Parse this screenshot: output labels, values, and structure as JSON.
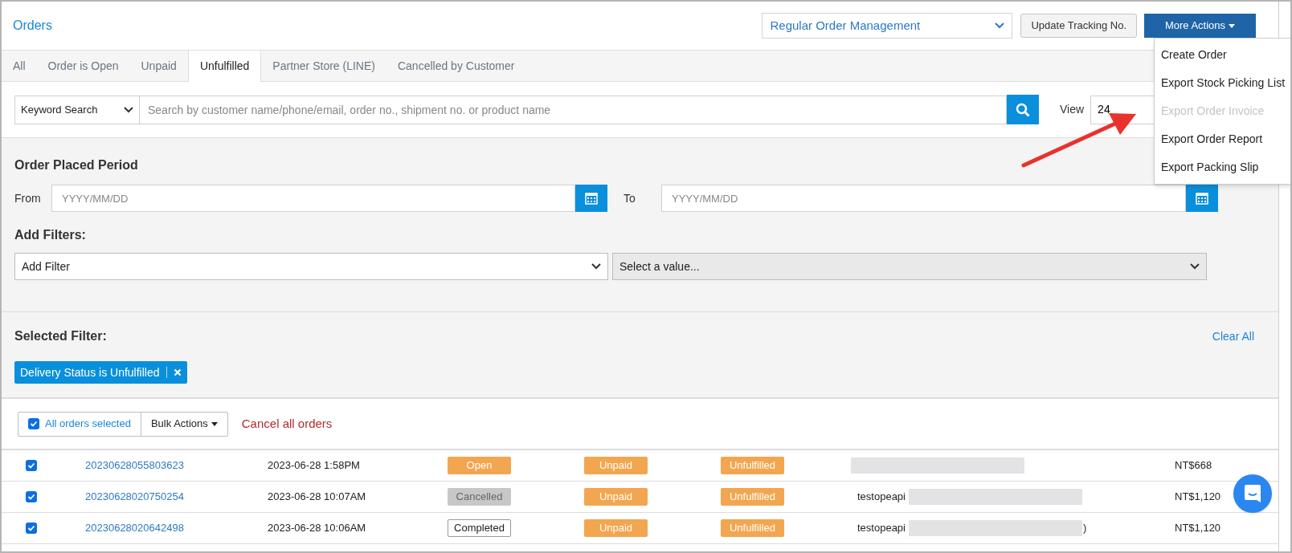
{
  "header": {
    "title": "Orders",
    "mode_select": "Regular Order Management",
    "update_button": "Update Tracking No.",
    "more_button": "More Actions"
  },
  "tabs": [
    {
      "label": "All",
      "selected": false
    },
    {
      "label": "Order is Open",
      "selected": false
    },
    {
      "label": "Unpaid",
      "selected": false
    },
    {
      "label": "Unfulfilled",
      "selected": true
    },
    {
      "label": "Partner Store (LINE)",
      "selected": false
    },
    {
      "label": "Cancelled by Customer",
      "selected": false
    }
  ],
  "search": {
    "type_select": "Keyword Search",
    "placeholder": "Search by customer name/phone/email, order no., shipment no. or product name",
    "view_label": "View",
    "view_value": "24"
  },
  "menu": [
    {
      "label": "Create Order",
      "disabled": false
    },
    {
      "label": "Export Stock Picking List",
      "disabled": false
    },
    {
      "label": "Export Order Invoice",
      "disabled": true
    },
    {
      "label": "Export Order Report",
      "disabled": false
    },
    {
      "label": "Export Packing Slip",
      "disabled": false
    }
  ],
  "period": {
    "title": "Order Placed Period",
    "from_label": "From",
    "from_placeholder": "YYYY/MM/DD",
    "to_label": "To",
    "to_placeholder": "YYYY/MM/DD"
  },
  "filters": {
    "title": "Add Filters:",
    "filter_select": "Add Filter",
    "value_select": "Select a value..."
  },
  "selected_filter": {
    "title": "Selected Filter:",
    "clear": "Clear All",
    "chips": [
      "Delivery Status is Unfulfilled"
    ]
  },
  "bulk": {
    "all_selected": "All orders selected",
    "checked": true,
    "bulk_button": "Bulk Actions",
    "cancel_link": "Cancel all orders"
  },
  "orders": [
    {
      "checked": true,
      "number": "20230628055803623",
      "date": "2023-06-28 1:58PM",
      "status": {
        "label": "Open",
        "kind": "filled"
      },
      "payment": {
        "label": "Unpaid",
        "kind": "filled"
      },
      "delivery": {
        "label": "Unfulfilled",
        "kind": "filled"
      },
      "total": "NT$668"
    },
    {
      "checked": true,
      "number": "20230628020750254",
      "date": "2023-06-28 10:07AM",
      "status": {
        "label": "Cancelled",
        "kind": "muted"
      },
      "payment": {
        "label": "Unpaid",
        "kind": "filled"
      },
      "delivery": {
        "label": "Unfulfilled",
        "kind": "filled"
      },
      "customer": "testopeapi",
      "total": "NT$1,120"
    },
    {
      "checked": true,
      "number": "20230628020642498",
      "date": "2023-06-28 10:06AM",
      "status": {
        "label": "Completed",
        "kind": "outline"
      },
      "payment": {
        "label": "Unpaid",
        "kind": "filled"
      },
      "delivery": {
        "label": "Unfulfilled",
        "kind": "filled"
      },
      "customer": "testopeapi",
      "customer_suffix": ")",
      "total": "NT$1,120"
    }
  ]
}
